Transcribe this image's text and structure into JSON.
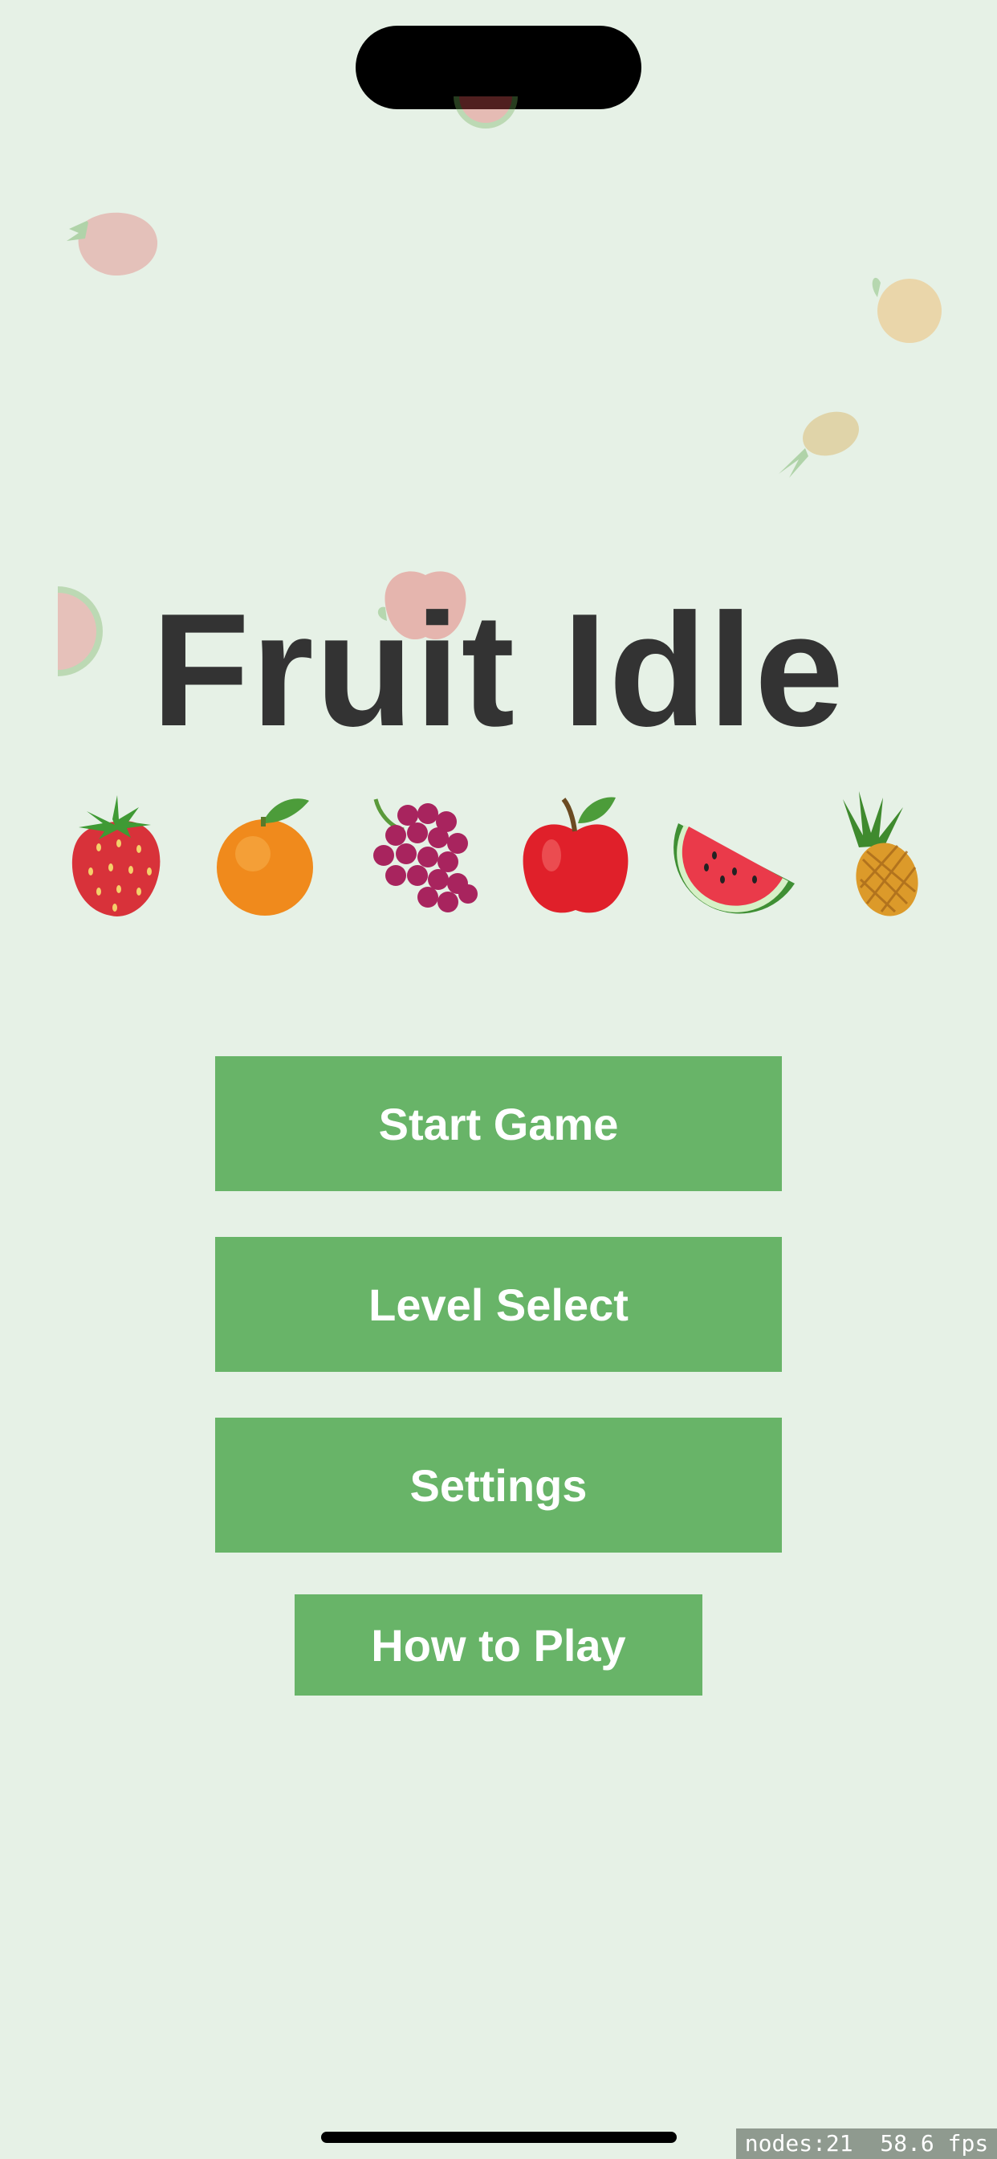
{
  "app": {
    "title": "Fruit Idle"
  },
  "fruit_row": [
    {
      "icon": "strawberry-icon"
    },
    {
      "icon": "orange-icon"
    },
    {
      "icon": "grapes-icon"
    },
    {
      "icon": "apple-icon"
    },
    {
      "icon": "watermelon-icon"
    },
    {
      "icon": "pineapple-icon"
    }
  ],
  "menu": {
    "start_label": "Start Game",
    "level_label": "Level Select",
    "settings_label": "Settings",
    "howto_label": "How to Play"
  },
  "stats": {
    "text": "nodes:21  58.6 fps"
  },
  "colors": {
    "background": "#e6f1e6",
    "button": "#68b468",
    "button_text": "#ffffff",
    "title_text": "#333333"
  }
}
